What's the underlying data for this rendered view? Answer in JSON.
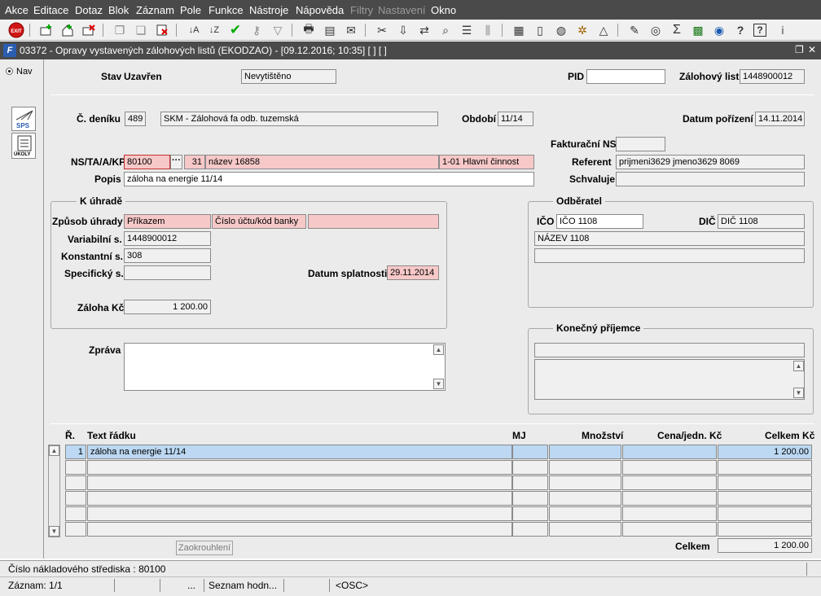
{
  "menu": [
    {
      "label": "Akce",
      "disabled": false
    },
    {
      "label": "Editace",
      "disabled": false
    },
    {
      "label": "Dotaz",
      "disabled": false
    },
    {
      "label": "Blok",
      "disabled": false
    },
    {
      "label": "Záznam",
      "disabled": false
    },
    {
      "label": "Pole",
      "disabled": false
    },
    {
      "label": "Funkce",
      "disabled": false
    },
    {
      "label": "Nástroje",
      "disabled": false
    },
    {
      "label": "Nápověda",
      "disabled": false
    },
    {
      "label": "Filtry",
      "disabled": true
    },
    {
      "label": "Nastavení",
      "disabled": true
    },
    {
      "label": "Okno",
      "disabled": false
    }
  ],
  "toolbar": {
    "exit_label": "EXIT",
    "icons": [
      "exit-icon",
      "insert-record-icon",
      "save-icon",
      "delete-record-icon",
      "copy-icon",
      "duplicate-icon",
      "clear-icon",
      "sort-asc-icon",
      "sort-desc-icon",
      "check-icon",
      "key-icon",
      "filter-icon",
      "print-icon",
      "print-preview-icon",
      "mail-icon",
      "cut-icon",
      "paste-icon",
      "transfer-icon",
      "search-icon",
      "list-icon",
      "columns-icon",
      "attach-icon",
      "document-icon",
      "globe-icon",
      "settings-icon",
      "chart-icon",
      "note-icon",
      "currency-icon",
      "sum-icon",
      "excel-icon",
      "outlook-icon",
      "help-query-icon",
      "help-icon",
      "info-icon"
    ]
  },
  "window": {
    "title": "03372 - Opravy vystavených zálohových listů (EKODZAO) - [09.12.2016; 10:35] [ ] [ ]",
    "logo": "F"
  },
  "leftnav": {
    "nav_label": "Nav",
    "sps_label": "SPS",
    "ukoly_label": "ÚKOLY"
  },
  "form": {
    "stav_label": "Stav",
    "stav_value": "Uzavřen",
    "tisk_value": "Nevytištěno",
    "pid_label": "PID",
    "pid_value": "",
    "zalohovy_list_label": "Zálohový list",
    "zalohovy_list_value": "1448900012",
    "c_deniku_label": "Č. deníku",
    "c_deniku_value": "489",
    "denik_name": "SKM - Zálohová fa odb. tuzemská",
    "obdobi_label": "Období",
    "obdobi_value": "11/14",
    "datum_porizeni_label": "Datum pořízení",
    "datum_porizeni_value": "14.11.2014",
    "fakturacni_ns_label": "Fakturační NS",
    "fakturacni_ns_value": "",
    "nstaakp_label": "NS/TA/A/KP",
    "ns_value": "80100",
    "ns_btn": "···",
    "ta_value": "31",
    "ta_name": "název 16858",
    "kp_value": "1-01 Hlavní činnost",
    "referent_label": "Referent",
    "referent_value": "prijmeni3629 jmeno3629 8069",
    "popis_label": "Popis",
    "popis_value": "záloha na energie 11/14",
    "schvaluje_label": "Schvaluje",
    "schvaluje_value": ""
  },
  "k_uhrade": {
    "title": "K úhradě",
    "zpusob_label": "Způsob úhrady",
    "zpusob_value": "Příkazem",
    "ucet_value": "Číslo účtu/kód banky",
    "ucet_extra": "",
    "var_label": "Variabilní s.",
    "var_value": "1448900012",
    "konst_label": "Konstantní s.",
    "konst_value": "308",
    "spec_label": "Specifický s.",
    "spec_value": "",
    "splatnost_label": "Datum splatnosti",
    "splatnost_value": "29.11.2014",
    "zaloha_label": "Záloha Kč",
    "zaloha_value": "1 200.00"
  },
  "odberatel": {
    "title": "Odběratel",
    "ico_label": "IČO",
    "ico_value": "IČO 1108",
    "dic_label": "DIČ",
    "dic_value": "DIČ 1108",
    "nazev_value": "NÁZEV 1108",
    "line2_value": ""
  },
  "prijemce": {
    "title": "Konečný příjemce",
    "line1": "",
    "line2": ""
  },
  "zprava": {
    "label": "Zpráva",
    "value": ""
  },
  "table": {
    "headers": {
      "r": "Ř.",
      "text": "Text řádku",
      "mj": "MJ",
      "mnozstvi": "Množství",
      "cena": "Cena/jedn. Kč",
      "celkem": "Celkem Kč"
    },
    "rows": [
      {
        "r": "1",
        "text": "záloha na energie 11/14",
        "mj": "",
        "mnozstvi": "",
        "cena": "",
        "celkem": "1 200.00"
      },
      {
        "r": "",
        "text": "",
        "mj": "",
        "mnozstvi": "",
        "cena": "",
        "celkem": ""
      },
      {
        "r": "",
        "text": "",
        "mj": "",
        "mnozstvi": "",
        "cena": "",
        "celkem": ""
      },
      {
        "r": "",
        "text": "",
        "mj": "",
        "mnozstvi": "",
        "cena": "",
        "celkem": ""
      },
      {
        "r": "",
        "text": "",
        "mj": "",
        "mnozstvi": "",
        "cena": "",
        "celkem": ""
      },
      {
        "r": "",
        "text": "",
        "mj": "",
        "mnozstvi": "",
        "cena": "",
        "celkem": ""
      }
    ],
    "zaokrouhleni_label": "Zaokrouhlení",
    "celkem_label": "Celkem",
    "celkem_value": "1 200.00"
  },
  "status": {
    "line1": "Číslo nákladového střediska : 80100",
    "zaznam": "Záznam: 1/1",
    "dots": "...",
    "seznam": "Seznam hodn...",
    "osc": "<OSC>"
  },
  "colors": {
    "bar_dark": "#4a4a4a",
    "form_bg": "#ebebeb",
    "required_pink": "#f7c8c8",
    "selected_row": "#bcd8f2"
  }
}
